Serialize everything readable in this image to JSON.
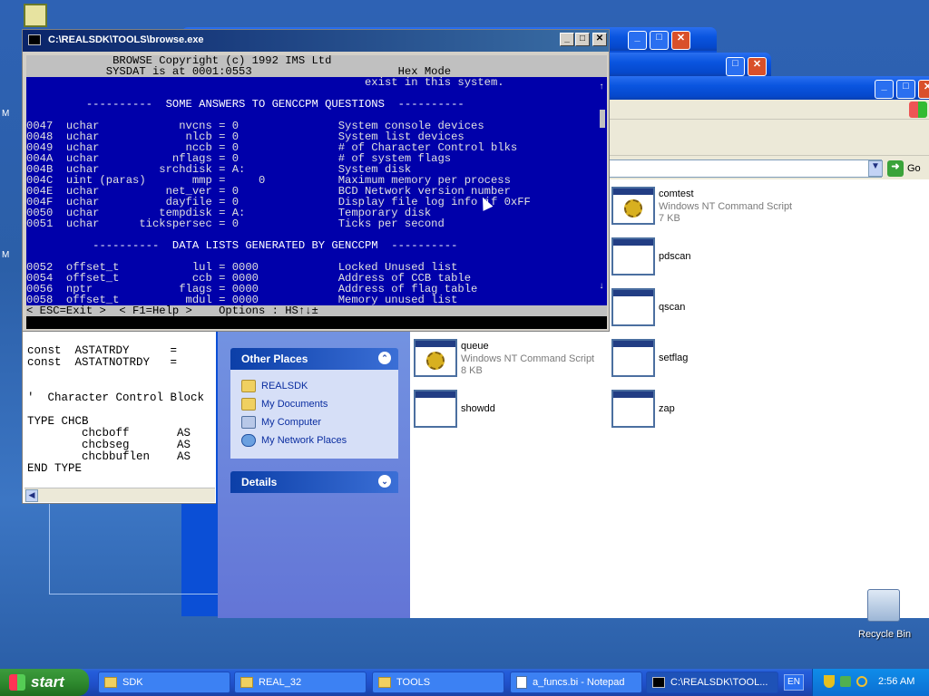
{
  "desktop": {
    "recycle_bin_label": "Recycle Bin",
    "left_edge_labels": [
      "M",
      "M"
    ]
  },
  "cmd_window": {
    "title": "C:\\REALSDK\\TOOLS\\browse.exe",
    "header_line1": "             BROWSE Copyright (c) 1992 IMS Ltd",
    "header_line2": "            SYSDAT is at 0001:0553                      Hex Mode",
    "lines": [
      "                                                   exist in this system.",
      "",
      "         ----------  SOME ANSWERS TO GENCCPM QUESTIONS  ----------",
      "",
      "0047  uchar            nvcns = 0               System console devices",
      "0048  uchar             nlcb = 0               System list devices",
      "0049  uchar             nccb = 0               # of Character Control blks",
      "004A  uchar           nflags = 0               # of system flags",
      "004B  uchar         srchdisk = A:              System disk",
      "004C  uint (paras)       mmp =     0           Maximum memory per process",
      "004E  uchar          net_ver = 0               BCD Network version number",
      "004F  uchar          dayfile = 0               Display file log info if 0xFF",
      "0050  uchar         tempdisk = A:              Temporary disk",
      "0051  uchar      tickspersec = 0               Ticks per second",
      "",
      "          ----------  DATA LISTS GENERATED BY GENCCPM  ----------",
      "",
      "0052  offset_t           lul = 0000            Locked Unused list",
      "0054  offset_t           ccb = 0000            Address of CCB table",
      "0056  nptr             flags = 0000            Address of flag table",
      "0058  offset_t          mdul = 0000            Memory unused list"
    ],
    "status_line": "< ESC=Exit >  < F1=Help >    Options : HS↑↓±"
  },
  "code_window": {
    "lines": [
      "const  ASTATRDY      =",
      "const  ASTATNOTRDY   =",
      "",
      "",
      "'  Character Control Block",
      "",
      "TYPE CHCB",
      "        chcboff       AS",
      "        chcbseg       AS",
      "        chcbbuflen    AS",
      "END TYPE"
    ]
  },
  "explorer": {
    "go_label": "Go",
    "other_places": {
      "title": "Other Places",
      "items": [
        "REALSDK",
        "My Documents",
        "My Computer",
        "My Network Places"
      ]
    },
    "details_title": "Details",
    "files": [
      {
        "name": "comtest",
        "type": "Windows NT Command Script",
        "size": "7 KB"
      },
      {
        "name": "pdscan",
        "type": "",
        "size": ""
      },
      {
        "name": "qscan",
        "type": "",
        "size": ""
      },
      {
        "name": "queue",
        "type": "Windows NT Command Script",
        "size": "8 KB"
      },
      {
        "name": "setflag",
        "type": "",
        "size": ""
      },
      {
        "name": "showdd",
        "type": "",
        "size": ""
      },
      {
        "name": "zap",
        "type": "",
        "size": ""
      }
    ]
  },
  "taskbar": {
    "start_label": "start",
    "buttons": [
      "SDK",
      "REAL_32",
      "TOOLS",
      "a_funcs.bi - Notepad",
      "C:\\REALSDK\\TOOL..."
    ],
    "language": "EN",
    "clock": "2:56 AM"
  }
}
